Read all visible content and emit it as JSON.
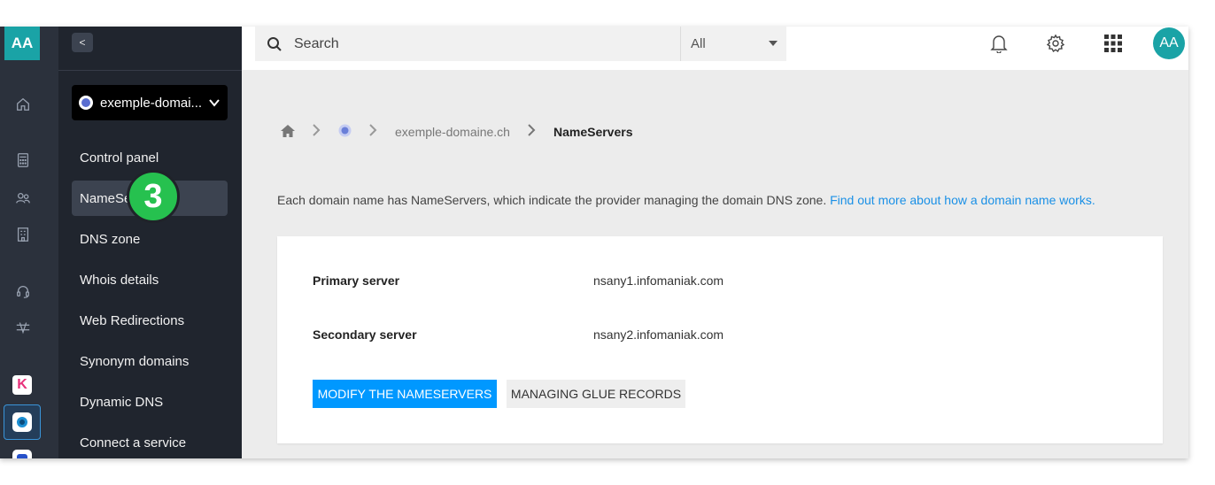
{
  "rail": {
    "avatar_initials": "AA",
    "icons": [
      "home-icon",
      "calculator-icon",
      "users-icon",
      "building-icon",
      "headset-icon",
      "network-icon"
    ],
    "apps": [
      "kchat-app-icon",
      "domain-app-icon",
      "shield-app-icon"
    ],
    "k_letter": "K"
  },
  "sidebar": {
    "collapse_glyph": "<",
    "domain_label": "exemple-domai...",
    "items": [
      {
        "label": "Control panel",
        "active": false
      },
      {
        "label": "NameServers",
        "active": true
      },
      {
        "label": "DNS zone",
        "active": false
      },
      {
        "label": "Whois details",
        "active": false
      },
      {
        "label": "Web Redirections",
        "active": false
      },
      {
        "label": "Synonym domains",
        "active": false
      },
      {
        "label": "Dynamic DNS",
        "active": false
      },
      {
        "label": "Connect a service",
        "active": false
      }
    ],
    "step_badge": "3"
  },
  "topbar": {
    "search_placeholder": "Search",
    "scope": "All",
    "user_initials": "AA"
  },
  "breadcrumb": {
    "domain": "exemple-domaine.ch",
    "current": "NameServers"
  },
  "intro": {
    "text": "Each domain name has NameServers, which indicate the provider managing the domain DNS zone.",
    "link": "Find out more about how a domain name works."
  },
  "servers": {
    "primary_label": "Primary server",
    "primary_value": "nsany1.infomaniak.com",
    "secondary_label": "Secondary server",
    "secondary_value": "nsany2.infomaniak.com"
  },
  "actions": {
    "modify": "MODIFY THE NAMESERVERS",
    "glue": "MANAGING GLUE RECORDS"
  },
  "colors": {
    "accent": "#0098ff",
    "teal": "#1aa3a6",
    "badge": "#26c14f",
    "link": "#1a90e6"
  }
}
